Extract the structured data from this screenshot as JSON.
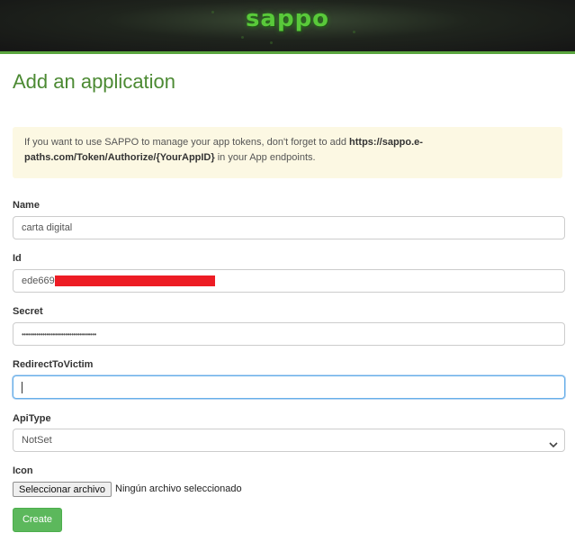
{
  "header": {
    "logo_text": "sappo"
  },
  "page": {
    "title": "Add an application"
  },
  "notice": {
    "text_before": "If you want to use SAPPO to manage your app tokens, don't forget to add ",
    "url": "https://sappo.e-paths.com/Token/Authorize/{YourAppID}",
    "text_after": " in your App endpoints."
  },
  "form": {
    "name": {
      "label": "Name",
      "value": "carta digital"
    },
    "id": {
      "label": "Id",
      "value": "ede669"
    },
    "secret": {
      "label": "Secret",
      "value": "••••••••••••••••••••••••••••••••••••"
    },
    "redirect": {
      "label": "RedirectToVictim",
      "value": ""
    },
    "api_type": {
      "label": "ApiType",
      "selected": "NotSet"
    },
    "icon": {
      "label": "Icon",
      "button_label": "Seleccionar archivo",
      "status": "Ningún archivo seleccionado"
    },
    "create_label": "Create"
  },
  "colors": {
    "brand_green": "#5aa53e",
    "title_green": "#4c8a33",
    "notice_bg": "#fcf8e3",
    "button_green": "#5cb85c",
    "redaction": "#ed1c24",
    "focus_border": "#66afe9"
  },
  "icons": {
    "select": "chevron-down-icon"
  }
}
